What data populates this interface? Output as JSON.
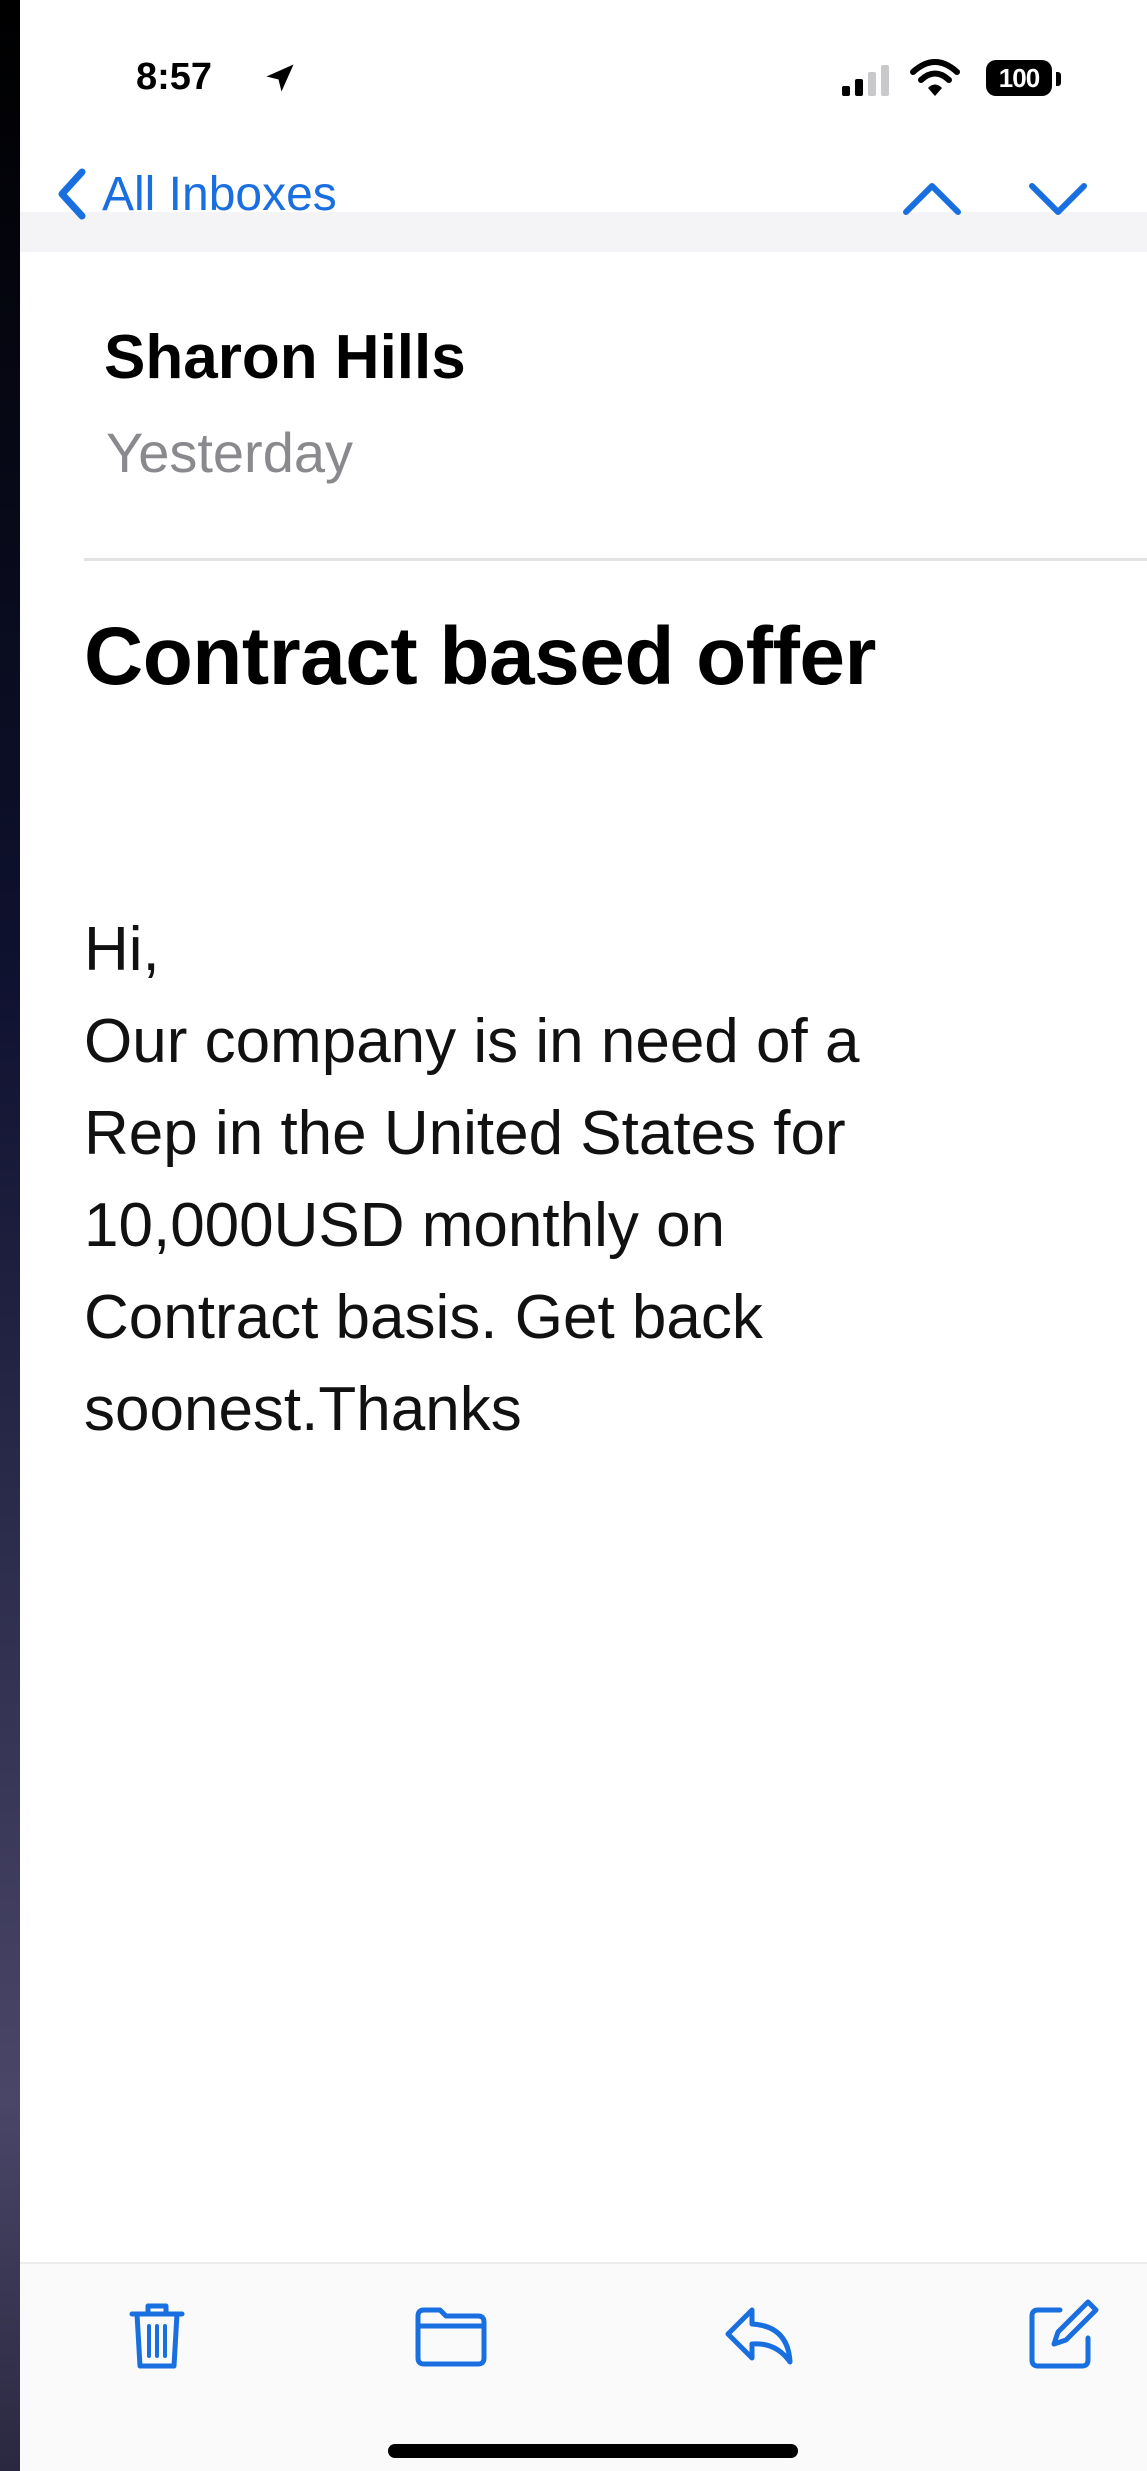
{
  "status_bar": {
    "time": "8:57",
    "battery": "100",
    "icons": [
      "location-arrow-icon",
      "cellular-signal-icon",
      "wifi-icon",
      "battery-icon"
    ]
  },
  "nav": {
    "back_label": "All Inboxes",
    "icons": [
      "chevron-left-icon",
      "chevron-up-icon",
      "chevron-down-icon"
    ],
    "accent_color": "#1a6fe0"
  },
  "message": {
    "sender": "Sharon Hills",
    "date": "Yesterday",
    "subject": "Contract based offer",
    "body_lines": [
      "Hi,",
      "Our company is in need of a",
      "Rep in the United States for",
      "10,000USD monthly on",
      "Contract basis. Get back",
      "soonest.Thanks"
    ]
  },
  "toolbar": {
    "icons": [
      "trash-icon",
      "folder-icon",
      "reply-icon",
      "compose-icon"
    ]
  }
}
